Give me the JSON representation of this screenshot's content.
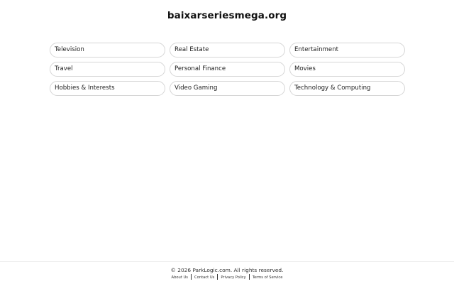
{
  "header": {
    "title": "baixarseriesmega.org"
  },
  "categories": [
    "Television",
    "Real Estate",
    "Entertainment",
    "Travel",
    "Personal Finance",
    "Movies",
    "Hobbies & Interests",
    "Video Gaming",
    "Technology & Computing"
  ],
  "footer": {
    "copyright": "© 2026 ParkLogic.com. All rights reserved.",
    "links": [
      "About Us",
      "Contact Us",
      "Privacy Policy",
      "Terms of Service"
    ]
  }
}
